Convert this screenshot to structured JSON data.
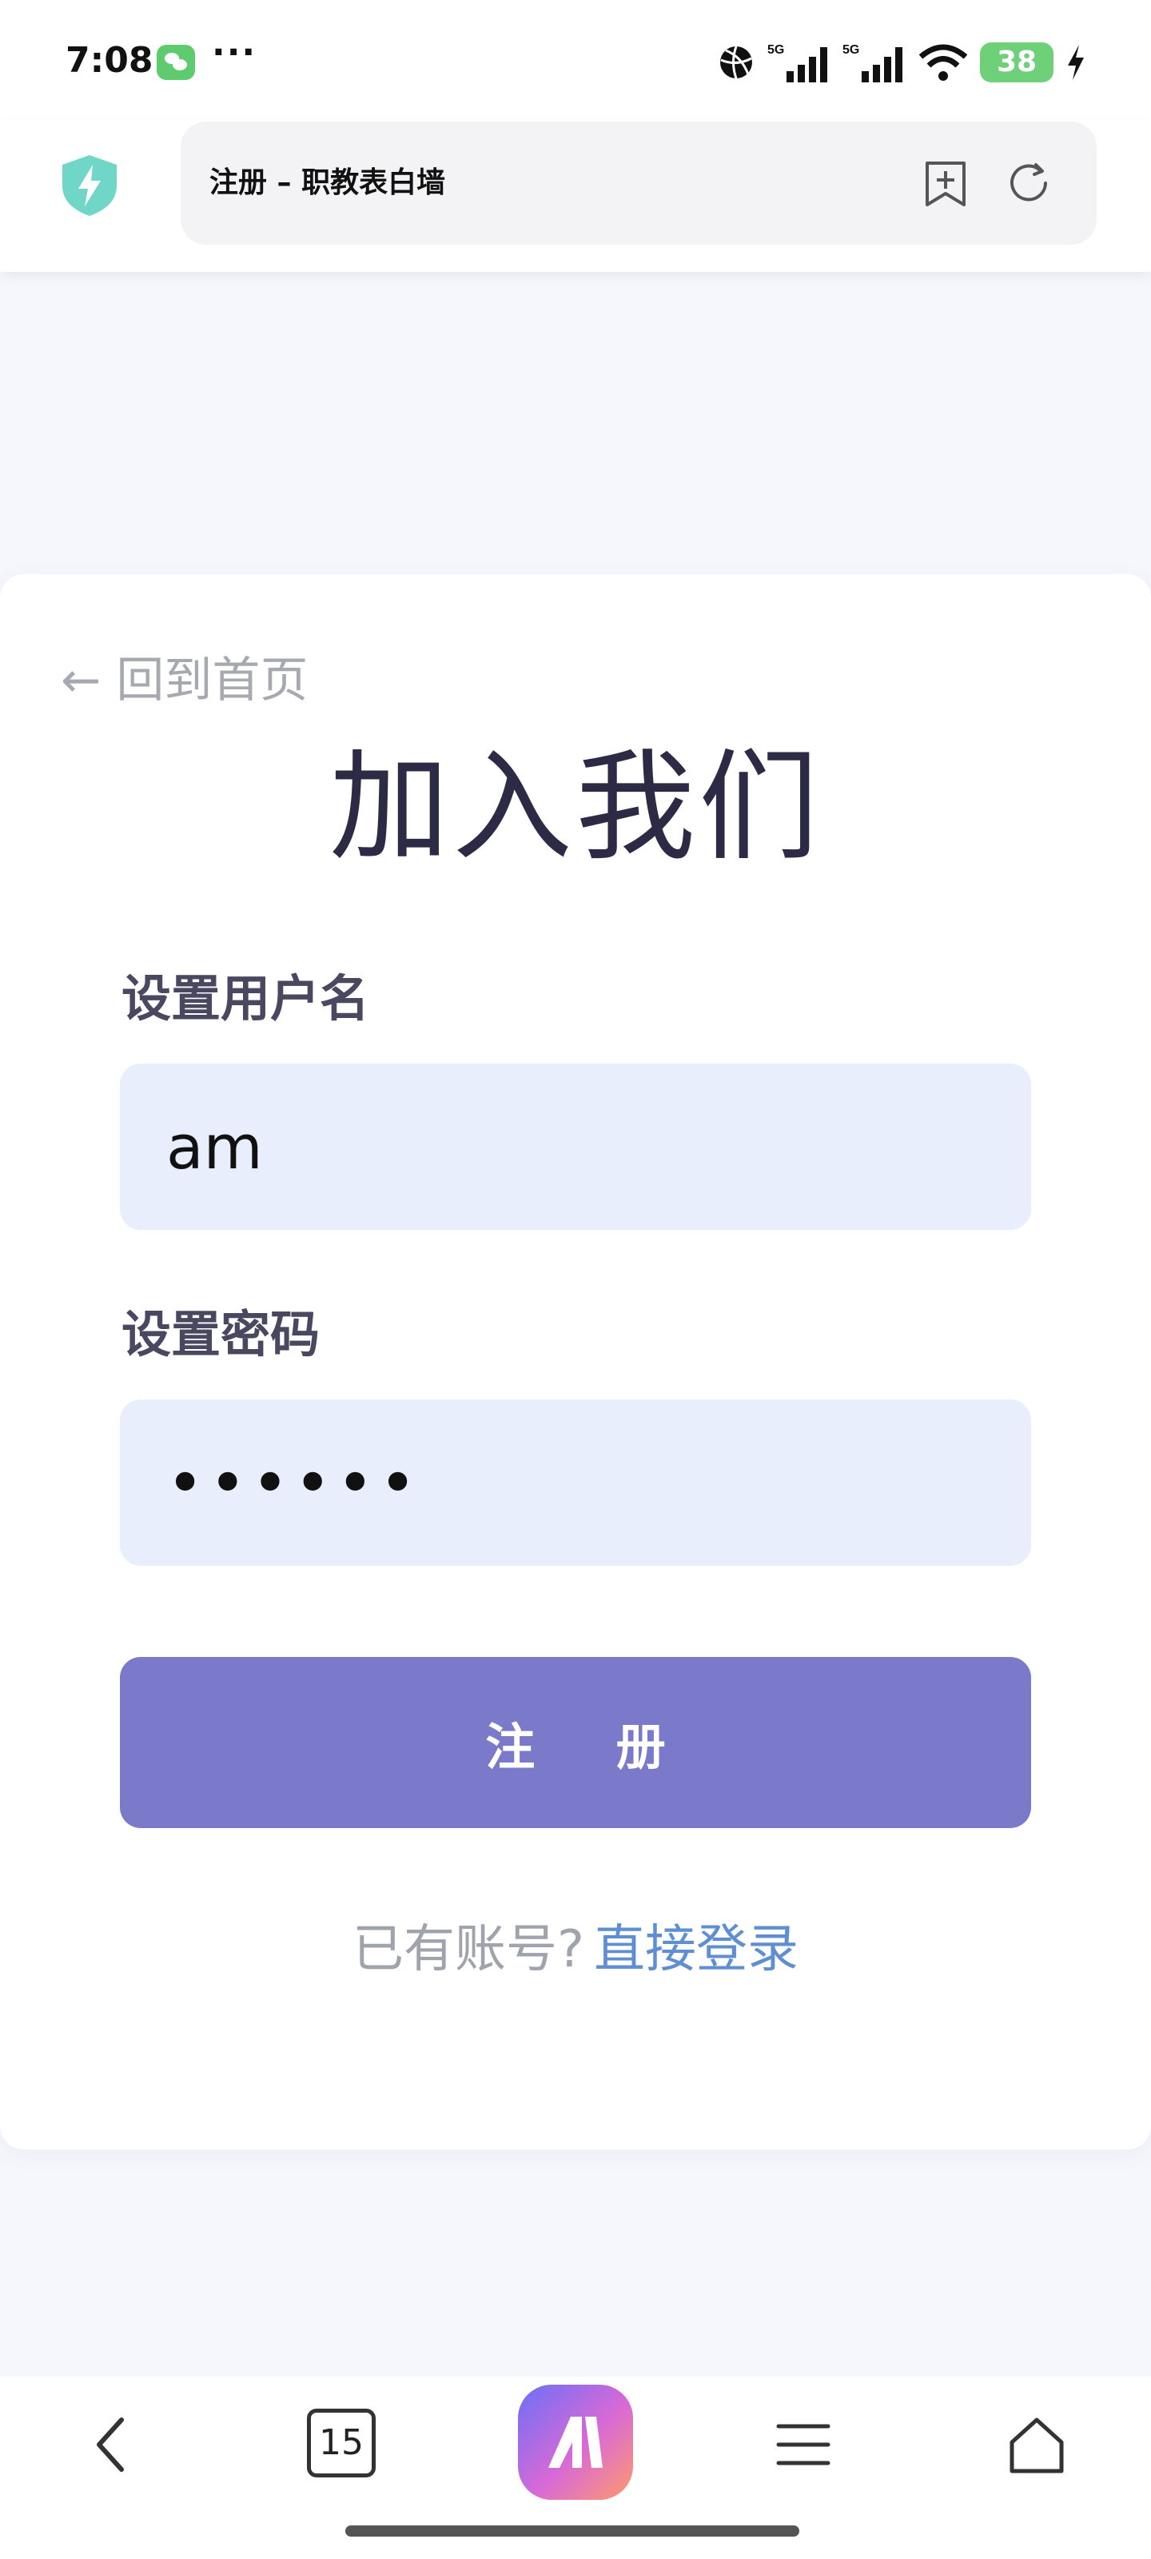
{
  "status_bar": {
    "time": "7:08",
    "more": "···",
    "battery": "38",
    "icons": [
      "wechat-icon",
      "basketball-icon",
      "signal-5g-icon",
      "signal-5g-icon",
      "wifi-icon",
      "battery-icon",
      "charging-icon"
    ]
  },
  "browser": {
    "title": "注册 – 职教表白墙",
    "icons": [
      "shield-bolt-icon",
      "add-bookmark-icon",
      "reload-icon"
    ]
  },
  "page": {
    "back_link": "← 回到首页",
    "heading": "加入我们",
    "username_label": "设置用户名",
    "username_value": "am",
    "password_label": "设置密码",
    "password_mask": "••••••",
    "submit_label": "注 册",
    "have_account": "已有账号?",
    "login_link": "直接登录"
  },
  "bottom_nav": {
    "tab_count": "15",
    "icons": [
      "back-arrow-icon",
      "tabs-icon",
      "assistant-app-icon",
      "menu-icon",
      "home-icon"
    ]
  },
  "colors": {
    "accent": "#7b79c9",
    "link": "#5f8ed1",
    "field_bg": "#e8eefb",
    "heading": "#2c2a45"
  }
}
